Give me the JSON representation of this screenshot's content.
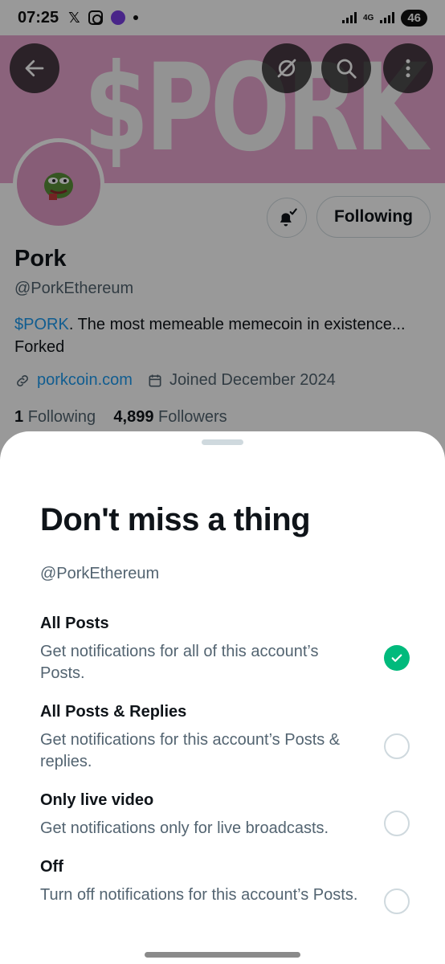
{
  "status_bar": {
    "time": "07:25",
    "x_label": "𝕏",
    "network": "4G",
    "battery": "46"
  },
  "header": {
    "banner_text": "$PORK",
    "back_icon": "arrow-left-icon",
    "grok_icon": "grok-icon",
    "search_icon": "search-icon",
    "more_icon": "more-vertical-icon"
  },
  "profile": {
    "name": "Pork",
    "handle": "@PorkEthereum",
    "bio_tag": "$PORK",
    "bio_rest": ". The most memeable memecoin in existence... Forked",
    "website": "porkcoin.com",
    "joined": "Joined December 2024",
    "following_count": "1",
    "following_label": "Following",
    "followers_count": "4,899",
    "followers_label": "Followers",
    "following_button": "Following"
  },
  "sheet": {
    "title": "Don't miss a thing",
    "handle": "@PorkEthereum",
    "options": [
      {
        "title": "All Posts",
        "desc": "Get notifications for all of this account’s Posts.",
        "selected": true
      },
      {
        "title": "All Posts & Replies",
        "desc": "Get notifications for this account’s Posts & replies.",
        "selected": false
      },
      {
        "title": "Only live video",
        "desc": "Get notifications only for live broadcasts.",
        "selected": false
      },
      {
        "title": "Off",
        "desc": "Turn off notifications for this account’s Posts.",
        "selected": false
      }
    ]
  },
  "colors": {
    "banner": "#e8a6cf",
    "accent_link": "#1d9bf0",
    "selected": "#00ba7c"
  }
}
